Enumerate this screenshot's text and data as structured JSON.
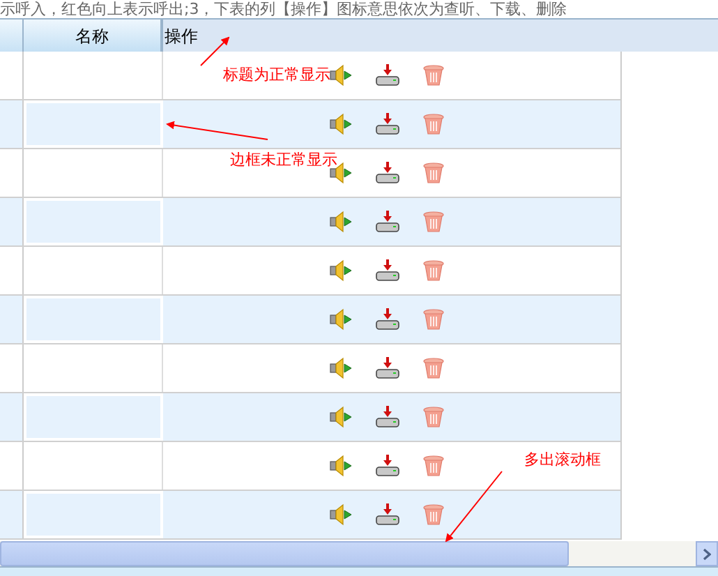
{
  "note": "示呼入，红色向上表示呼出;3，下表的列【操作】图标意思依次为查听、下载、删除",
  "table": {
    "columns": [
      "名称",
      "操作"
    ],
    "rows": [
      {
        "shaded": false
      },
      {
        "shaded": true
      },
      {
        "shaded": false
      },
      {
        "shaded": true
      },
      {
        "shaded": false
      },
      {
        "shaded": true
      },
      {
        "shaded": false
      },
      {
        "shaded": true
      },
      {
        "shaded": false
      },
      {
        "shaded": true
      }
    ]
  },
  "annotations": [
    "标题为正常显示",
    "边框未正常显示",
    "多出滚动框"
  ]
}
